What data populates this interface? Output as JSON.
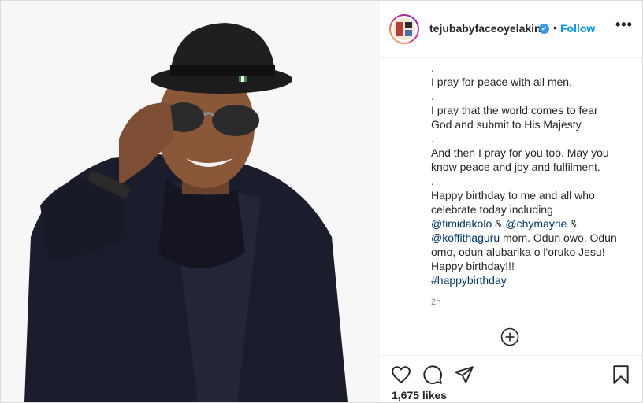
{
  "post": {
    "username": "tejubabyfaceoyelakin",
    "follow_label": "Follow",
    "separator": "•",
    "more_label": "•••",
    "caption_lines": [
      ".",
      "I pray for peace with all men.",
      ".",
      "I pray that the world comes to fear",
      "God and submit to His Majesty.",
      ".",
      "And then I pray for you too. May you",
      "know peace and joy and fulfilment.",
      ".",
      "Happy birthday to me and all who",
      "celebrate today including"
    ],
    "mention_1": "@timidakolo",
    "amp_1": " & ",
    "mention_2": "@chymayrie",
    "amp_2": " &",
    "mention_3": "@koffithaguru",
    "after_mention_3": " mom. Odun owo, Odun",
    "tail_lines": [
      "omo, odun alubarika o l'oruko Jesu!",
      "Happy birthday!!!"
    ],
    "hashtag": "#happybirthday",
    "time_ago": "2h",
    "likes": "1,675 likes"
  },
  "icons": {
    "verified": "verified-badge-icon",
    "load_more": "plus-circle-icon",
    "like": "heart-icon",
    "comment": "comment-icon",
    "share": "share-icon",
    "save": "bookmark-icon"
  },
  "colors": {
    "link": "#00376b",
    "follow": "#0095f6",
    "muted": "#8e8e8e"
  }
}
